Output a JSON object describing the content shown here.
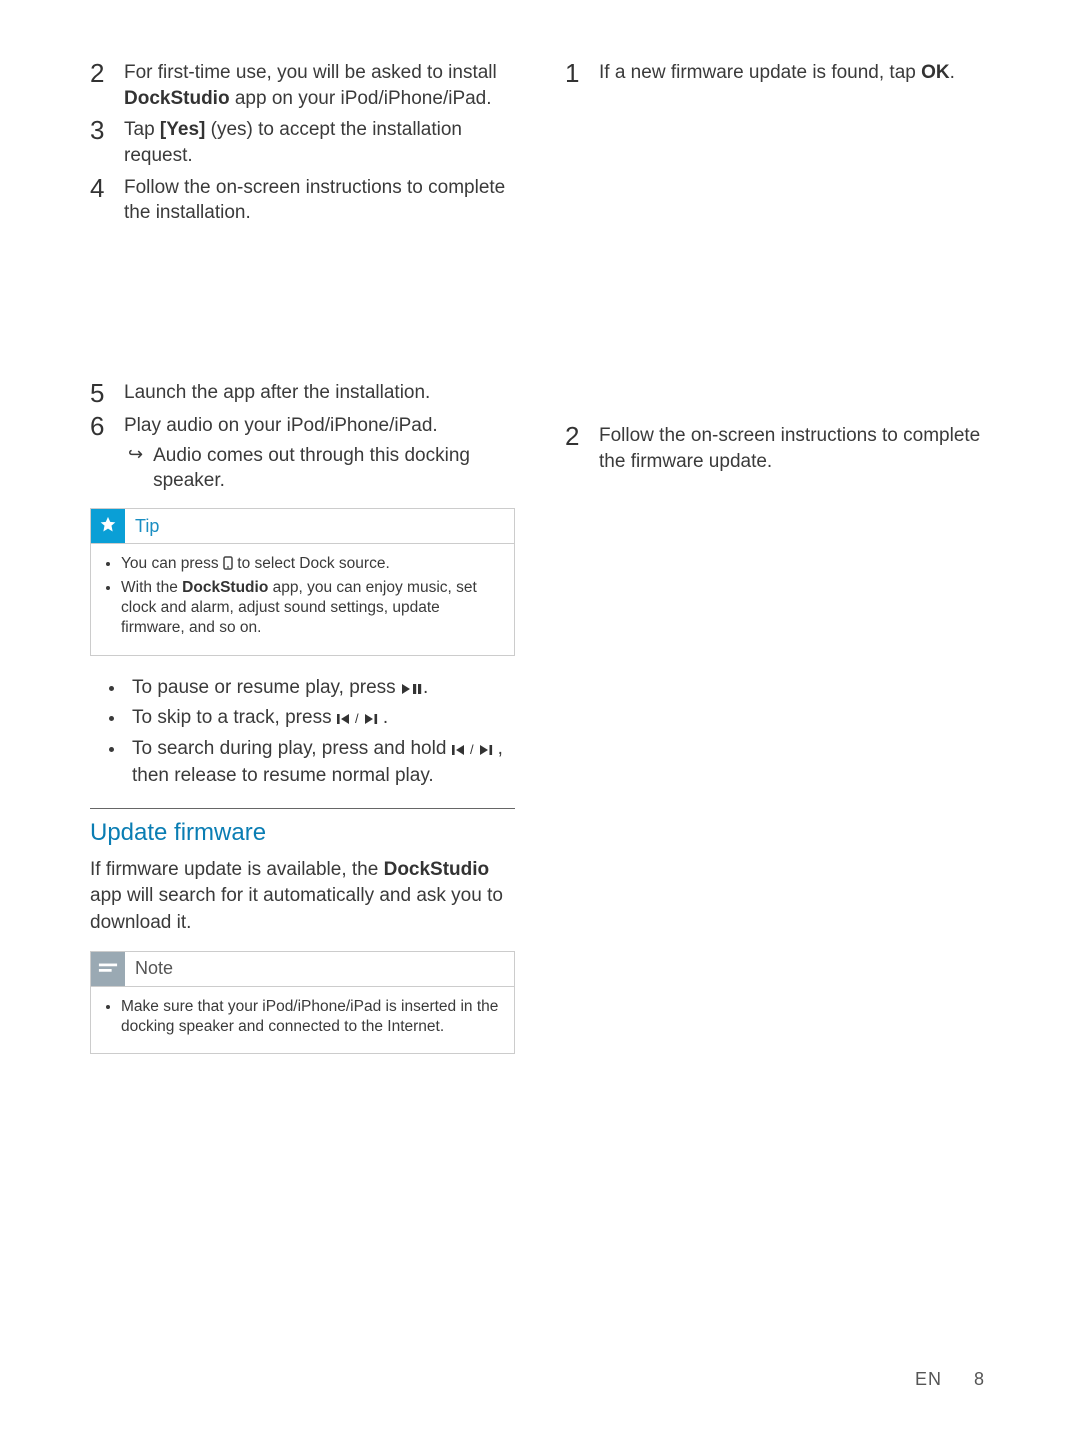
{
  "left": {
    "steps_a": [
      {
        "num": "2",
        "text_pre": "For first-time use, you will be asked to install ",
        "bold": "DockStudio",
        "text_post": " app on your iPod/iPhone/iPad."
      },
      {
        "num": "3",
        "text_pre": "Tap ",
        "bold": "[Yes]",
        "text_post": " (yes) to accept the installation request."
      },
      {
        "num": "4",
        "text_pre": "Follow the on-screen instructions to complete the installation.",
        "bold": "",
        "text_post": ""
      }
    ],
    "steps_b": [
      {
        "num": "5",
        "text": "Launch the app after the installation."
      },
      {
        "num": "6",
        "text": "Play audio on your iPod/iPhone/iPad.",
        "result": "Audio comes out through this docking speaker."
      }
    ],
    "tip": {
      "title": "Tip",
      "items": [
        {
          "pre": "You can press ",
          "icon": "dock",
          "post": " to select Dock source."
        },
        {
          "pre": "With the ",
          "bold": "DockStudio",
          "post": " app, you can enjoy music, set clock and alarm, adjust sound settings, update firmware, and so on."
        }
      ]
    },
    "controls": [
      {
        "pre": "To pause or resume play, press ",
        "icon": "playpause",
        "post": "."
      },
      {
        "pre": "To skip to a track, press ",
        "icon": "prevnext",
        "post": "."
      },
      {
        "pre": "To search during play, press and hold ",
        "icon": "prevnext",
        "post": ", then release to resume normal play."
      }
    ],
    "update": {
      "title": "Update firmware",
      "text_pre": "If firmware update is available, the ",
      "bold": "DockStudio",
      "text_post": " app will search for it automatically and ask you to download it."
    },
    "note": {
      "title": "Note",
      "item": "Make sure that your iPod/iPhone/iPad is inserted in the docking speaker and connected to the Internet."
    }
  },
  "right": {
    "steps_a": [
      {
        "num": "1",
        "text_pre": "If a new firmware update is found, tap ",
        "bold": "OK",
        "text_post": "."
      }
    ],
    "steps_b": [
      {
        "num": "2",
        "text": "Follow the on-screen instructions to complete the firmware update."
      }
    ]
  },
  "footer": {
    "lang": "EN",
    "page": "8"
  },
  "icons": {
    "dock": "▯",
    "playpause": "▶❙❙",
    "prev": "❙◀",
    "next": "▶❙",
    "result_arrow": "↪"
  }
}
